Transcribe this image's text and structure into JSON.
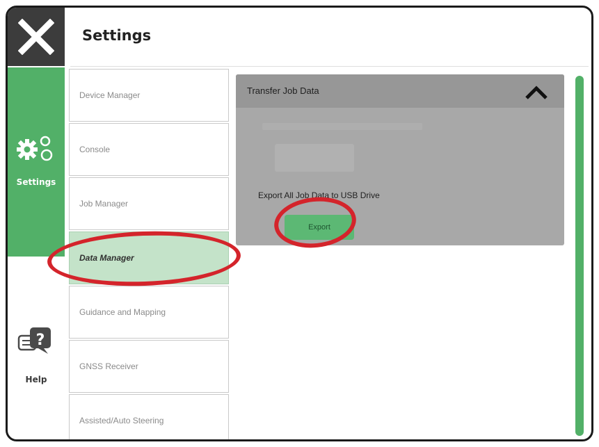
{
  "header": {
    "title": "Settings"
  },
  "rail": {
    "close_icon": "close-x-icon",
    "settings": {
      "label": "Settings",
      "icon": "gears-icon",
      "color": "#52b068"
    },
    "help": {
      "label": "Help",
      "icon": "help-chat-icon"
    }
  },
  "menu": {
    "items": [
      {
        "label": "Device Manager"
      },
      {
        "label": "Console"
      },
      {
        "label": "Job Manager"
      },
      {
        "label": "Data Manager",
        "selected": true
      },
      {
        "label": "Guidance and Mapping"
      },
      {
        "label": "GNSS Receiver"
      },
      {
        "label": "Assisted/Auto Steering"
      }
    ]
  },
  "content": {
    "section_title": "Transfer Job Data",
    "collapse_icon": "chevron-up-icon",
    "export_label": "Export All Job Data to USB Drive",
    "export_button": "Export"
  },
  "colors": {
    "accent": "#52b068",
    "highlight": "#d4242b",
    "selected_bg": "#c4e3c9"
  }
}
